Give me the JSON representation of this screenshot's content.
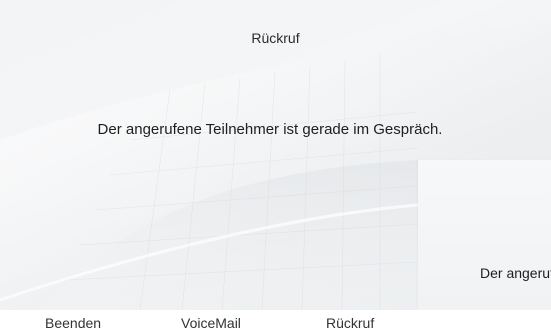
{
  "call_screen": {
    "title": "Rückruf",
    "message": "Der angerufene Teilnehmer ist gerade im Gespräch.",
    "overlapping_window_text": "Der angerufene Teilnehmer ist gerade im Gespräch."
  },
  "softkeys": [
    {
      "label": "Beenden"
    },
    {
      "label": "VoiceMail"
    },
    {
      "label": "Rückruf"
    }
  ]
}
